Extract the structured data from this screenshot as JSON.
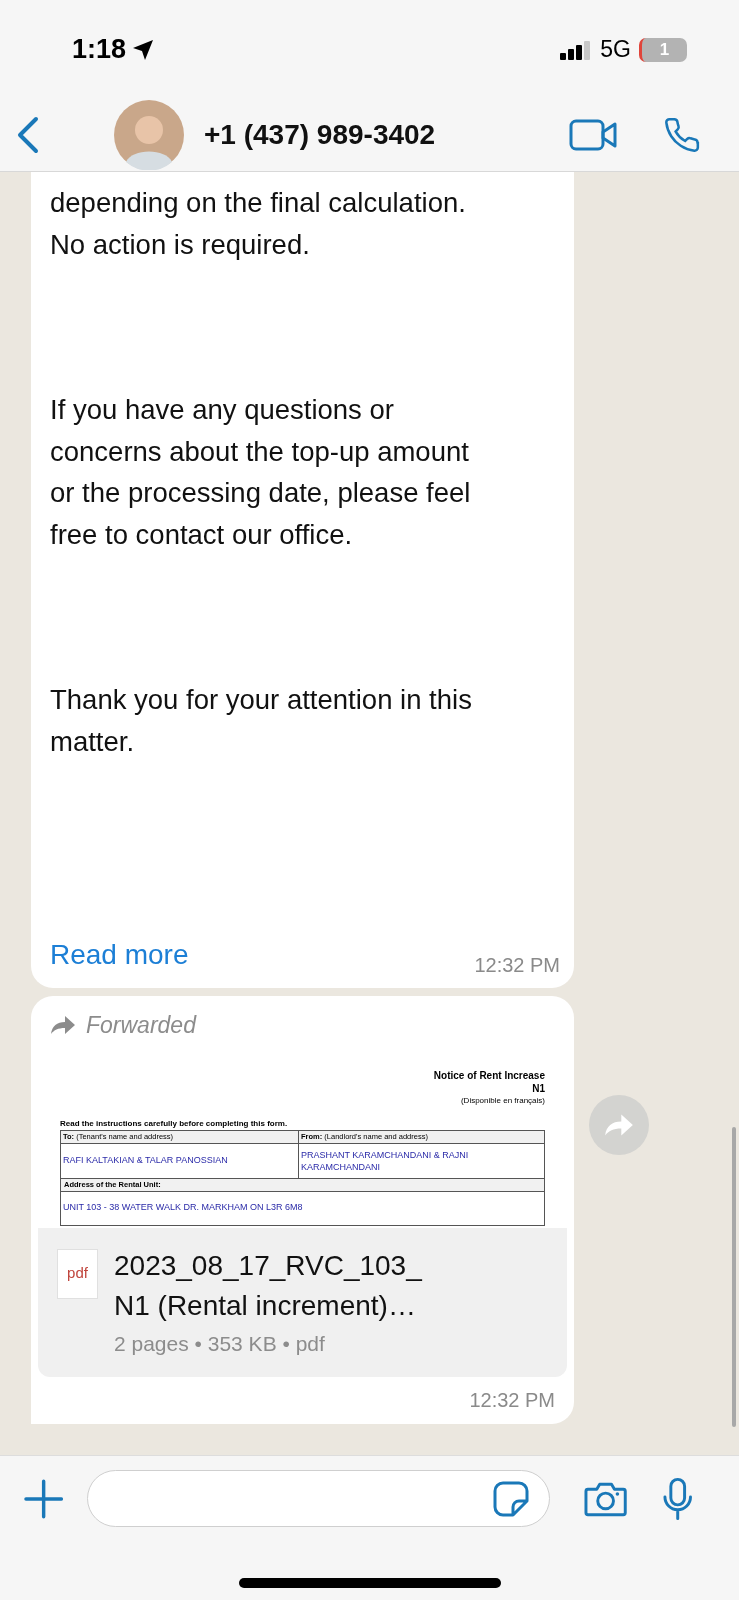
{
  "status_bar": {
    "time": "1:18",
    "network": "5G",
    "battery": "1"
  },
  "header": {
    "contact": "+1 (437) 989-3402"
  },
  "messages": [
    {
      "kind": "text",
      "paragraphs": [
        [
          "depending on the final calculation.",
          "No action is required."
        ],
        [
          "If you have any questions or",
          "concerns about the top-up amount",
          "or the processing date, please feel",
          "free to contact our office."
        ],
        [
          "Thank you for your attention in this",
          "matter."
        ]
      ],
      "read_more": "Read more",
      "time": "12:32 PM"
    },
    {
      "kind": "document",
      "forwarded": "Forwarded",
      "preview": {
        "title": "Notice of Rent Increase",
        "form": "N1",
        "language_note": "(Disponible en français)",
        "instructions": "Read the instructions carefully before completing this form.",
        "to_label": "To:",
        "to_hint": "(Tenant's name and address)",
        "from_label": "From:",
        "from_hint": "(Landlord's name and address)",
        "tenant": "RAFI KALTAKIAN & TALAR PANOSSIAN",
        "landlord": "PRASHANT KARAMCHANDANI & RAJNI KARAMCHANDANI",
        "address_label": "Address of the Rental Unit:",
        "address": "UNIT 103 - 38 WATER WALK DR. MARKHAM ON L3R 6M8"
      },
      "file_type_badge": "pdf",
      "file_name": [
        "2023_08_17_RVC_103_",
        "N1 (Rental increment)…"
      ],
      "file_meta": "2 pages • 353 KB • pdf",
      "time": "12:32 PM"
    }
  ]
}
